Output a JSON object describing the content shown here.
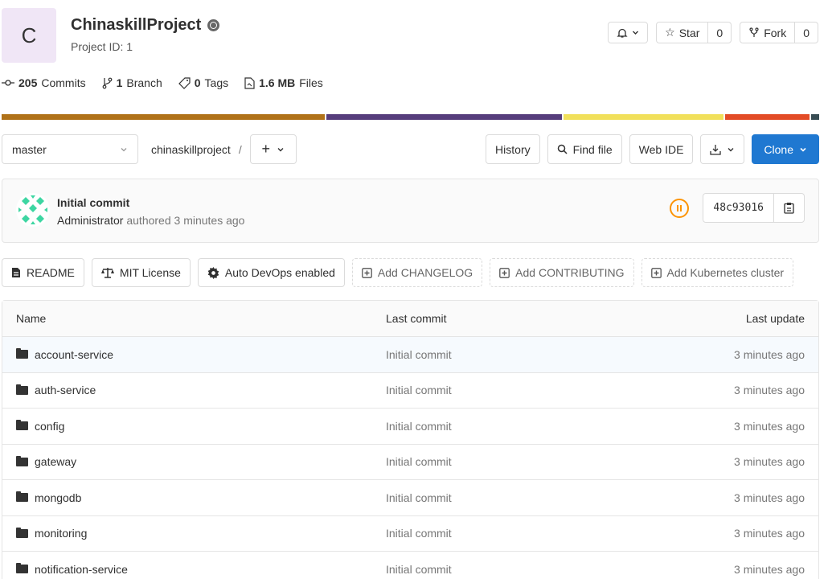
{
  "project": {
    "avatar_letter": "C",
    "name": "ChinaskillProject",
    "id_label": "Project ID: 1"
  },
  "header_buttons": {
    "star_label": "Star",
    "star_count": "0",
    "fork_label": "Fork",
    "fork_count": "0"
  },
  "stats": {
    "commits_count": "205",
    "commits_label": "Commits",
    "branch_count": "1",
    "branch_label": "Branch",
    "tags_count": "0",
    "tags_label": "Tags",
    "files_size": "1.6 MB",
    "files_label": "Files"
  },
  "language_bar": {
    "colors": [
      "#b07219",
      "#563d7c",
      "#f1e05a",
      "#e34c26",
      "#384d54"
    ],
    "fractions": [
      0.398,
      0.291,
      0.197,
      0.104,
      0.01
    ]
  },
  "toolbar": {
    "branch": "master",
    "path_root": "chinaskillproject",
    "separator": "/",
    "history": "History",
    "find_file": "Find file",
    "web_ide": "Web IDE",
    "clone": "Clone"
  },
  "commit": {
    "title": "Initial commit",
    "author": "Administrator",
    "authored_text": "authored 3 minutes ago",
    "sha": "48c93016"
  },
  "quick_links": {
    "readme": "README",
    "license": "MIT License",
    "autodevops": "Auto DevOps enabled",
    "changelog": "Add CHANGELOG",
    "contributing": "Add CONTRIBUTING",
    "kubernetes": "Add Kubernetes cluster"
  },
  "table": {
    "headers": {
      "name": "Name",
      "last_commit": "Last commit",
      "last_update": "Last update"
    },
    "rows": [
      {
        "name": "account-service",
        "commit": "Initial commit",
        "updated": "3 minutes ago"
      },
      {
        "name": "auth-service",
        "commit": "Initial commit",
        "updated": "3 minutes ago"
      },
      {
        "name": "config",
        "commit": "Initial commit",
        "updated": "3 minutes ago"
      },
      {
        "name": "gateway",
        "commit": "Initial commit",
        "updated": "3 minutes ago"
      },
      {
        "name": "mongodb",
        "commit": "Initial commit",
        "updated": "3 minutes ago"
      },
      {
        "name": "monitoring",
        "commit": "Initial commit",
        "updated": "3 minutes ago"
      },
      {
        "name": "notification-service",
        "commit": "Initial commit",
        "updated": "3 minutes ago"
      }
    ]
  }
}
